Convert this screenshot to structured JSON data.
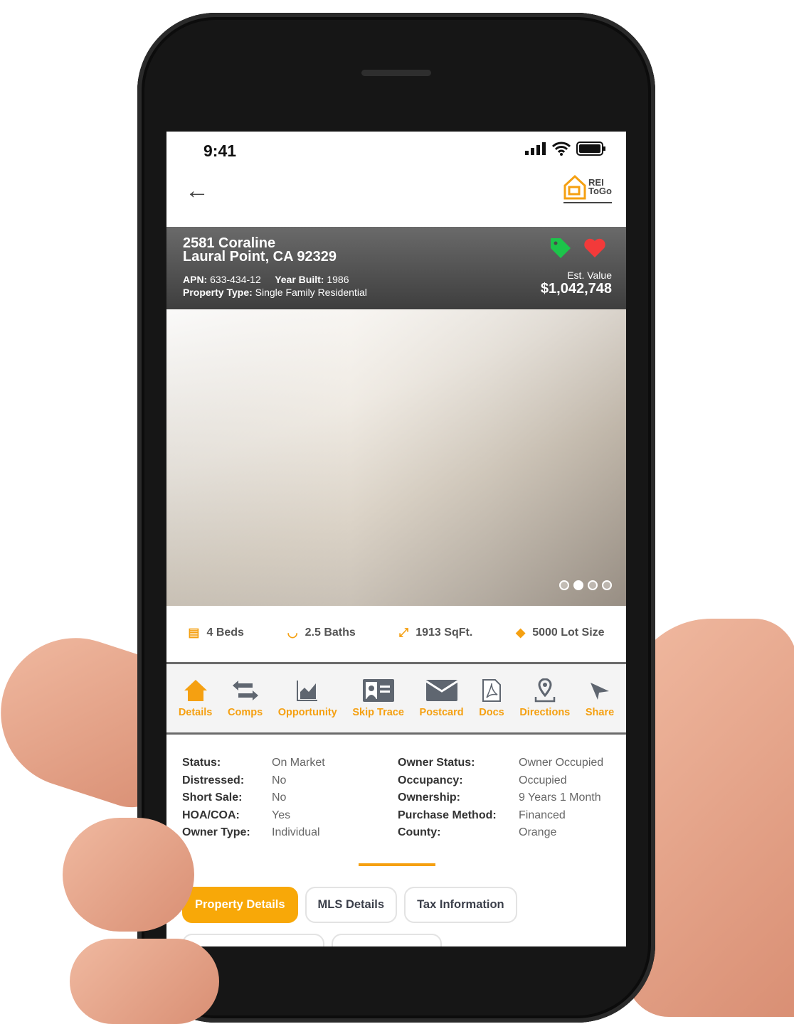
{
  "status_bar": {
    "time": "9:41"
  },
  "header": {
    "logo_text_1": "REI",
    "logo_text_2": "ToGo"
  },
  "property": {
    "street": "2581 Coraline",
    "city": "Laural Point, CA 92329",
    "apn_label": "APN:",
    "apn": "633-434-12",
    "year_label": "Year Built:",
    "year": "1986",
    "type_label": "Property Type:",
    "type": "Single Family Residential",
    "est_label": "Est. Value",
    "est_value": "$1,042,748"
  },
  "photo": {
    "slide_count": 4,
    "active_slide": 2
  },
  "stats": [
    {
      "icon": "bed-icon",
      "label": "4 Beds"
    },
    {
      "icon": "bathtub-icon",
      "label": "2.5 Baths"
    },
    {
      "icon": "expand-icon",
      "label": "1913 SqFt."
    },
    {
      "icon": "layers-icon",
      "label": "5000 Lot Size"
    }
  ],
  "actions": [
    {
      "icon": "home-icon",
      "label": "Details"
    },
    {
      "icon": "swap-arrows-icon",
      "label": "Comps"
    },
    {
      "icon": "chart-icon",
      "label": "Opportunity"
    },
    {
      "icon": "id-card-icon",
      "label": "Skip Trace"
    },
    {
      "icon": "envelope-icon",
      "label": "Postcard"
    },
    {
      "icon": "pdf-icon",
      "label": "Docs"
    },
    {
      "icon": "map-pin-icon",
      "label": "Directions"
    },
    {
      "icon": "paper-plane-icon",
      "label": "Share"
    }
  ],
  "details": [
    [
      "Status:",
      "On Market",
      "Owner Status:",
      "Owner Occupied"
    ],
    [
      "Distressed:",
      "No",
      "Occupancy:",
      "Occupied"
    ],
    [
      "Short Sale:",
      "No",
      "Ownership:",
      "9 Years 1 Month"
    ],
    [
      "HOA/COA:",
      "Yes",
      "Purchase Method:",
      "Financed"
    ],
    [
      "Owner Type:",
      "Individual",
      "County:",
      "Orange"
    ]
  ],
  "tabs": [
    {
      "label": "Property Details",
      "active": true
    },
    {
      "label": "MLS Details"
    },
    {
      "label": "Tax Information"
    }
  ],
  "colors": {
    "accent": "#f5a011",
    "tag": "#1cc44a",
    "heart": "#f33a3a",
    "icon_gray": "#5f6670"
  }
}
